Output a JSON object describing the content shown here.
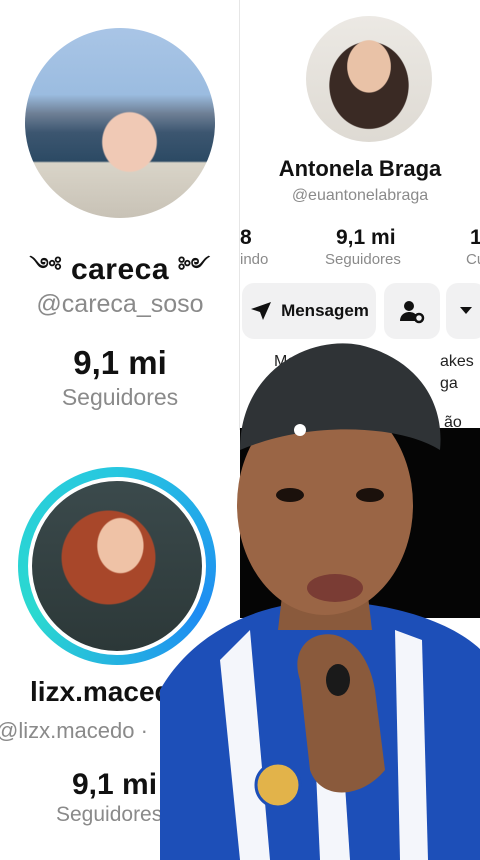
{
  "profile_left_top": {
    "name": "careca",
    "ornament_left": "༺",
    "ornament_right": "༻",
    "handle": "@careca_soso",
    "followers_count": "9,1 mi",
    "followers_label": "Seguidores"
  },
  "profile_right": {
    "name": "Antonela Braga",
    "handle": "@euantonelabraga",
    "stat_left_num": "8",
    "stat_left_label": "indo",
    "stat_mid_num": "9,1 mi",
    "stat_mid_label": "Seguidores",
    "stat_right_num": "1",
    "stat_right_label": "Cu",
    "message_button": "Mensagem",
    "bio_line1_left": "Mo",
    "bio_line1_right": "akes",
    "bio_line2_right": "ga",
    "bio_line3_right": "ão"
  },
  "profile_left_bottom": {
    "name": "lizx.macedo",
    "handle": "@lizx.macedo · ",
    "followers_count": "9,1 mi",
    "followers_label": "Seguidores"
  },
  "colors": {
    "story_ring_start": "#27c7e0",
    "story_ring_end": "#1e8bf2",
    "text_primary": "#111111",
    "text_secondary": "#8a8a8a",
    "button_bg": "#f1f1f2"
  }
}
